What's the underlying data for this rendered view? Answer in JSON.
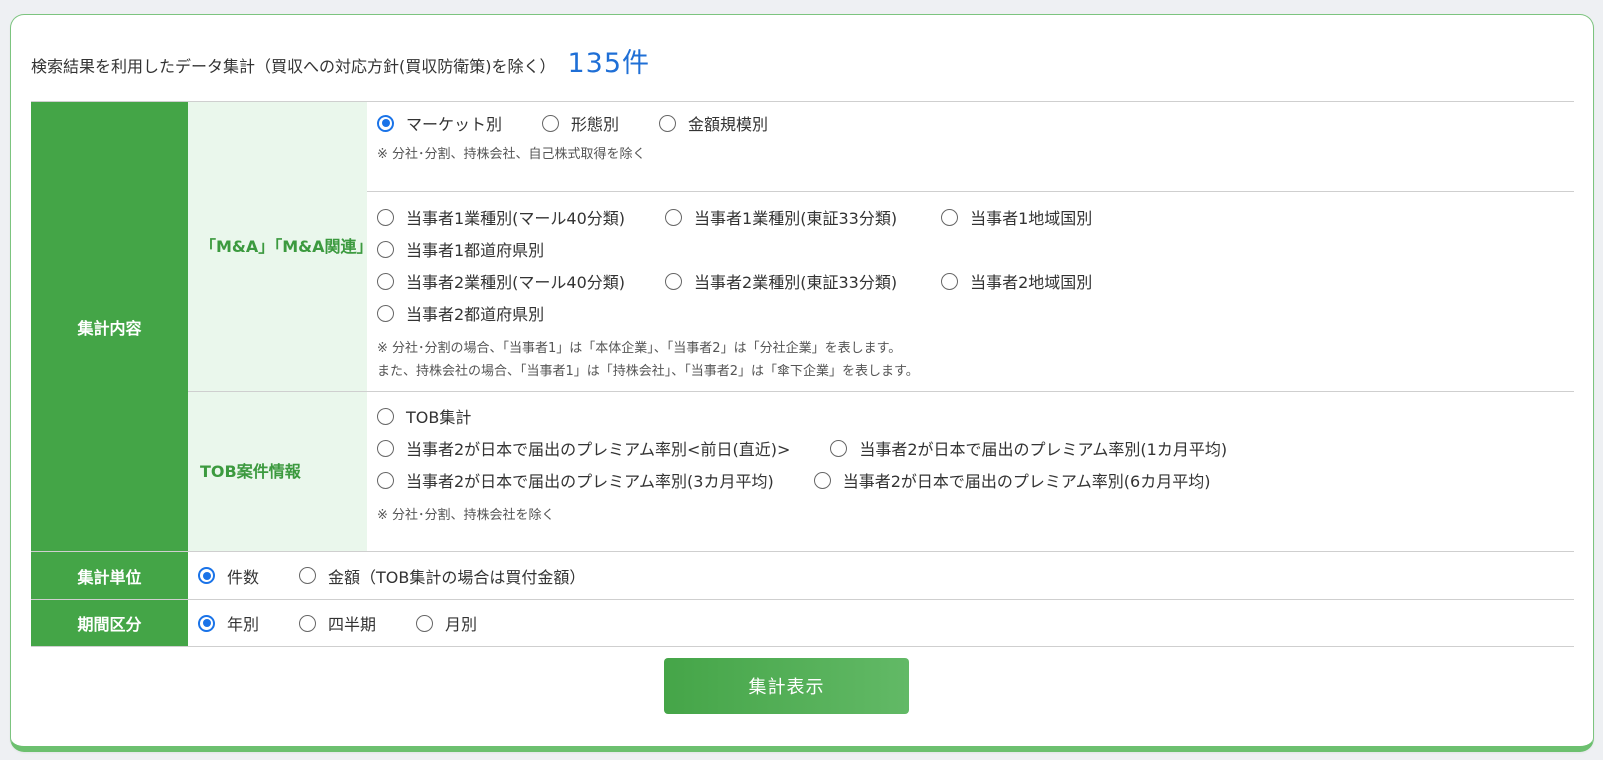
{
  "header": {
    "text": "検索結果を利用したデータ集計（買収への対応方針(買収防衛策)を除く）",
    "count": "135件"
  },
  "aggregation": {
    "label": "集計内容",
    "ma": {
      "label": "「M&A」「M&A関連」",
      "market_options": [
        {
          "label": "マーケット別",
          "checked": true
        },
        {
          "label": "形態別",
          "checked": false
        },
        {
          "label": "金額規模別",
          "checked": false
        }
      ],
      "market_note": "※ 分社･分割、持株会社、自己株式取得を除く",
      "party_options": [
        "当事者1業種別(マール40分類)",
        "当事者1業種別(東証33分類)",
        "当事者1地域国別",
        "当事者1都道府県別",
        "当事者2業種別(マール40分類)",
        "当事者2業種別(東証33分類)",
        "当事者2地域国別",
        "当事者2都道府県別"
      ],
      "party_note_1": "※ 分社･分割の場合、「当事者1」は「本体企業」、「当事者2」は「分社企業」を表します。",
      "party_note_2": "また、持株会社の場合、「当事者1」は「持株会社」、「当事者2」は「傘下企業」を表します。"
    },
    "tob": {
      "label": "TOB案件情報",
      "options": [
        "TOB集計",
        "当事者2が日本で届出のプレミアム率別<前日(直近)>",
        "当事者2が日本で届出のプレミアム率別(1カ月平均)",
        "当事者2が日本で届出のプレミアム率別(3カ月平均)",
        "当事者2が日本で届出のプレミアム率別(6カ月平均)"
      ],
      "note": "※ 分社･分割、持株会社を除く"
    }
  },
  "unit": {
    "label": "集計単位",
    "options": [
      {
        "label": "件数",
        "checked": true
      },
      {
        "label": "金額（TOB集計の場合は買付金額）",
        "checked": false
      }
    ]
  },
  "period": {
    "label": "期間区分",
    "options": [
      {
        "label": "年別",
        "checked": true
      },
      {
        "label": "四半期",
        "checked": false
      },
      {
        "label": "月別",
        "checked": false
      }
    ]
  },
  "submit_label": "集計表示",
  "colors": {
    "accent_green": "#44a547",
    "light_green": "#eaf7ec",
    "count_blue": "#1f6fd6",
    "radio_blue": "#1a73e8"
  }
}
